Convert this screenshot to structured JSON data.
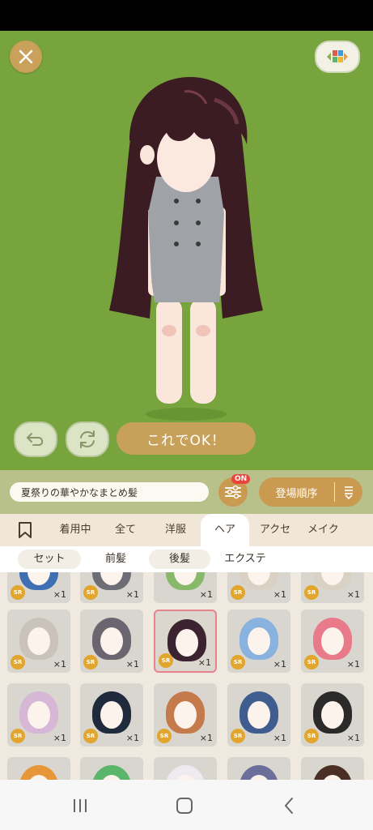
{
  "preview": {
    "ok_label": "これでOK！"
  },
  "item_bar": {
    "selected_item_name": "夏祭りの華やかなまとめ髪",
    "filter_badge": "ON",
    "sort_label": "登場順序"
  },
  "tabs": [
    {
      "label": ""
    },
    {
      "label": "着用中"
    },
    {
      "label": "全て"
    },
    {
      "label": "洋服"
    },
    {
      "label": "ヘア"
    },
    {
      "label": "アクセ"
    },
    {
      "label": "メイク"
    }
  ],
  "subtabs": [
    {
      "label": "セット"
    },
    {
      "label": "前髪"
    },
    {
      "label": "後髪"
    },
    {
      "label": "エクステ"
    }
  ],
  "items": [
    {
      "rarity": "SR",
      "qty": "×1",
      "hair_color": "#3e6fb2"
    },
    {
      "rarity": "SR",
      "qty": "×1",
      "hair_color": "#6d6d75"
    },
    {
      "rarity": "",
      "qty": "×1",
      "hair_color": "#88b86a"
    },
    {
      "rarity": "SR",
      "qty": "×1",
      "hair_color": "#d9d1c4"
    },
    {
      "rarity": "SR",
      "qty": "×1",
      "hair_color": "#d9d1c4"
    },
    {
      "rarity": "SR",
      "qty": "×1",
      "hair_color": "#c9c3bc"
    },
    {
      "rarity": "SR",
      "qty": "×1",
      "hair_color": "#6b6570"
    },
    {
      "rarity": "SR",
      "qty": "×1",
      "hair_color": "#3b2330"
    },
    {
      "rarity": "SR",
      "qty": "×1",
      "hair_color": "#8ab2df"
    },
    {
      "rarity": "SR",
      "qty": "×1",
      "hair_color": "#e87a8a"
    },
    {
      "rarity": "SR",
      "qty": "×1",
      "hair_color": "#d6b8d6"
    },
    {
      "rarity": "SR",
      "qty": "×1",
      "hair_color": "#1f2a3c"
    },
    {
      "rarity": "SR",
      "qty": "×1",
      "hair_color": "#c47a4a"
    },
    {
      "rarity": "SR",
      "qty": "×1",
      "hair_color": "#3f5e8f"
    },
    {
      "rarity": "SR",
      "qty": "×1",
      "hair_color": "#2a2a2a"
    },
    {
      "rarity": "",
      "qty": "",
      "hair_color": "#e8963a"
    },
    {
      "rarity": "",
      "qty": "",
      "hair_color": "#5bb56a"
    },
    {
      "rarity": "",
      "qty": "",
      "hair_color": "#efeaf0"
    },
    {
      "rarity": "",
      "qty": "",
      "hair_color": "#6b6f99"
    },
    {
      "rarity": "",
      "qty": "",
      "hair_color": "#4a3024"
    }
  ],
  "colors": {
    "stage_bg": "#77a43d",
    "accent": "#c7a15a",
    "selected_border": "#e6838c",
    "sr_badge": "#e2a52e"
  }
}
